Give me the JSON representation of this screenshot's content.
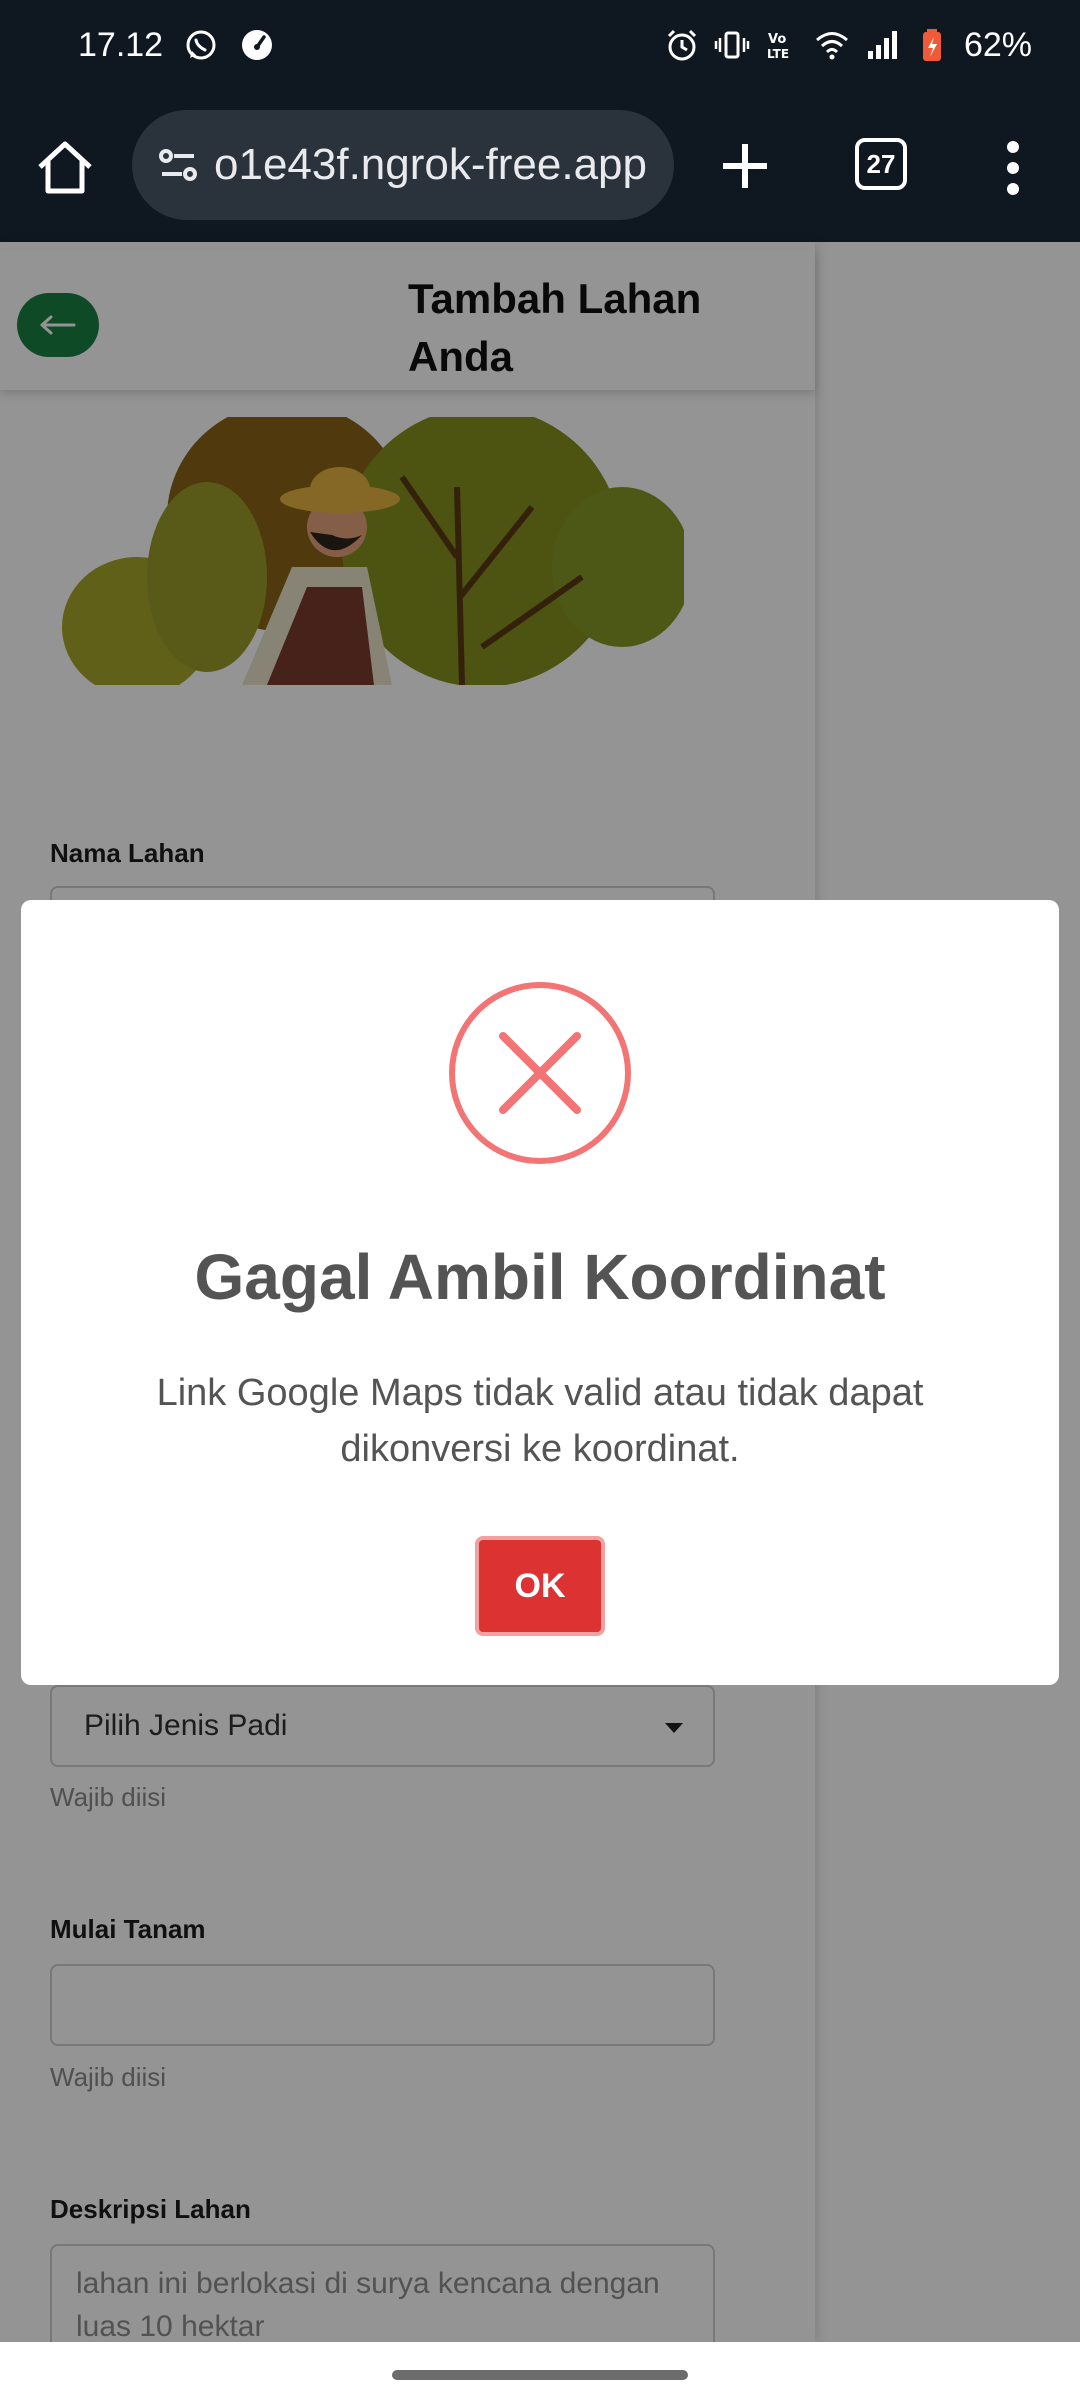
{
  "status_bar": {
    "time": "17.12",
    "battery": "62%",
    "icons": [
      "whatsapp-icon",
      "speedometer-icon",
      "alarm-icon",
      "vibrate-icon",
      "volte-icon",
      "wifi-icon",
      "signal-icon",
      "battery-icon"
    ]
  },
  "browser": {
    "url": "o1e43f.ngrok-free.app",
    "tab_count": "27"
  },
  "page": {
    "title": "Tambah Lahan Anda",
    "fields": {
      "nama_lahan_label": "Nama Lahan",
      "jenis_padi_value": "Pilih Jenis Padi",
      "jenis_padi_hint": "Wajib diisi",
      "mulai_tanam_label": "Mulai Tanam",
      "mulai_tanam_hint": "Wajib diisi",
      "deskripsi_label": "Deskripsi Lahan",
      "deskripsi_value": "lahan ini berlokasi di surya kencana dengan luas 10 hektar"
    }
  },
  "dialog": {
    "title": "Gagal Ambil Koordinat",
    "message": "Link Google Maps tidak valid atau tidak dapat dikonversi ke koordinat.",
    "ok_label": "OK",
    "icon": "error-x-icon",
    "accent_color": "#f27474",
    "button_color": "#dc3232"
  }
}
